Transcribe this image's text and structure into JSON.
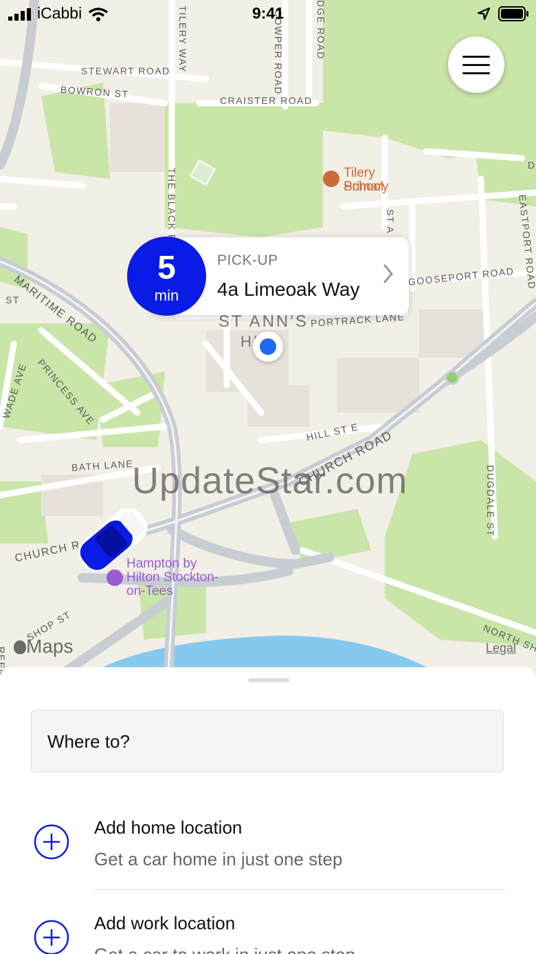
{
  "status_bar": {
    "carrier": "iCabbi",
    "time": "9:41"
  },
  "map": {
    "streets": {
      "stewart_road": "STEWART ROAD",
      "bowron_st": "BOWRON ST",
      "tilery_way": "TILERY WAY",
      "cowper_road": "COWPER ROAD",
      "dge_road": "DGE ROAD",
      "craister_road": "CRAISTER ROAD",
      "the_black_p": "THE BLACK P",
      "maritime_road": "MARITIME ROAD",
      "st_left": "ST",
      "princess_ave": "PRINCESS AVE",
      "wade_ave": "WADE AVE",
      "bath_lane": "BATH LANE",
      "church_road_left": "CHURCH R",
      "bishop_st": "SHOP ST",
      "church_road": "CHURCH ROAD",
      "hill_st_e": "HILL ST E",
      "portrack_lane": "PORTRACK LANE",
      "gooseport_road": "GOOSEPORT ROAD",
      "eastport_road": "EASTPORT ROAD",
      "dugdale_st": "DUGDALE ST",
      "north_sh": "NORTH SH",
      "st_a": "ST A",
      "st_anns": "ST ANN'S",
      "hi": "HI",
      "d_right": "D",
      "reen": "REEN"
    },
    "pois": {
      "school_line1": "Tilery Primary",
      "school_line2": "School",
      "hotel_line1": "Hampton by",
      "hotel_line2": "Hilton Stockton-",
      "hotel_line3": "on-Tees"
    },
    "maps_logo": "Maps",
    "legal": "Legal",
    "watermark": "UpdateStar.com",
    "colors": {
      "park": "#c9e5a8",
      "water": "#86c9ef",
      "road": "#ffffff",
      "highway": "#c8cdd3",
      "school": "#c96c3a",
      "hotel": "#9b5bd6"
    }
  },
  "menu_button_icon": "hamburger-icon",
  "eta": {
    "number": "5",
    "unit": "min"
  },
  "pickup": {
    "caption": "PICK-UP",
    "address": "4a Limeoak Way"
  },
  "sheet": {
    "search_label": "Where to?",
    "shortcuts": [
      {
        "title": "Add home location",
        "subtitle": "Get a car home in just one step"
      },
      {
        "title": "Add work location",
        "subtitle": "Get a car to work in just one step"
      }
    ]
  },
  "accent_color": "#0a1be6"
}
